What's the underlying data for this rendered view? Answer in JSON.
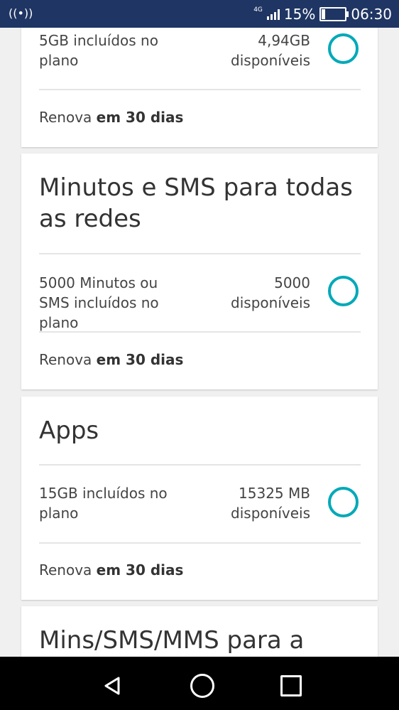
{
  "status": {
    "network": "4G",
    "battery": "15%",
    "time": "06:30"
  },
  "cards": [
    {
      "title": "",
      "left": "5GB incluídos no plano",
      "right_value": "4,94GB",
      "right_label": "disponíveis",
      "renew_prefix": "Renova",
      "renew_strong": "em 30 dias"
    },
    {
      "title": "Minutos e SMS para todas as redes",
      "left": "5000 Minutos ou SMS incluídos no plano",
      "right_value": "5000",
      "right_label": "disponíveis",
      "renew_prefix": "Renova",
      "renew_strong": "em 30 dias"
    },
    {
      "title": "Apps",
      "left": "15GB incluídos no plano",
      "right_value": "15325 MB",
      "right_label": "disponíveis",
      "renew_prefix": "Renova",
      "renew_strong": "em 30 dias"
    },
    {
      "title": "Mins/SMS/MMS para a"
    }
  ],
  "nav": {
    "back_icon": "back-triangle",
    "home_icon": "home-circle",
    "recent_icon": "recent-square"
  },
  "accent": "#00a9b8"
}
